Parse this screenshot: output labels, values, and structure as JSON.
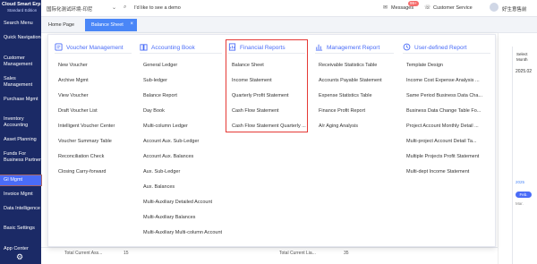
{
  "app": {
    "brand_line1": "Cloud Smart Erp",
    "brand_line2": "Standard Edition",
    "env_title": "国际化测试环境-印尼",
    "demo_link": "I'd like to see a demo",
    "messages_label": "Messages",
    "messages_badge": "99+",
    "customer_service_label": "Customer Service",
    "user_name": "好生意售前"
  },
  "sidebar": {
    "items": [
      {
        "label": "Search Menu"
      },
      {
        "label": "Quick Navigation"
      },
      {
        "label": "Customer Management"
      },
      {
        "label": "Sales Management"
      },
      {
        "label": "Purchase Mgmt"
      },
      {
        "label": "Inventory Accounting"
      },
      {
        "label": "Asset Planning"
      },
      {
        "label": "Funds For Business Partner"
      },
      {
        "label": "GI Mgmt"
      },
      {
        "label": "Invoice Mgmt"
      },
      {
        "label": "Data Intelligence"
      },
      {
        "label": "Basic Settings"
      },
      {
        "label": "App Center"
      }
    ]
  },
  "tabs": {
    "home": "Home Page",
    "active": "Balance Sheet"
  },
  "menu": {
    "columns": [
      {
        "title": "Voucher Management",
        "items": [
          "New Voucher",
          "Archive Mgmt",
          "View Voucher",
          "Draft Voucher List",
          "Intelligent Voucher Center",
          "Voucher Summary Table",
          "Reconciliation Check",
          "Closing Carry-forward"
        ]
      },
      {
        "title": "Accounting Book",
        "items": [
          "General Ledger",
          "Sub-ledger",
          "Balance Report",
          "Day Book",
          "Multi-column Ledger",
          "Account Aux. Sub-Ledger",
          "Account Aux. Balances",
          "Aux. Sub-Ledger",
          "Aux. Balances",
          "Multi-Auxiliary Detailed Account",
          "Multi-Auxiliary Balances",
          "Multi-Auxiliary Multi-column Account"
        ]
      },
      {
        "title": "Financial Reports",
        "items": [
          "Balance Sheet",
          "Income Statement",
          "Quarterly Profit Statement",
          "Cash Flow Statement",
          "Cash Flow Statement Quarterly ..."
        ]
      },
      {
        "title": "Management Report",
        "items": [
          "Receivable Statistics Table",
          "Accounts Payable Statement",
          "Expense Statistics Table",
          "Finance Profit Report",
          "A/r Aging Analysis"
        ]
      },
      {
        "title": "User-defined Report",
        "items": [
          "Template Design",
          "Income Cost Expense Analysis ...",
          "Same Period Business Data Cha...",
          "Business Data Change Table Fo...",
          "Project Account Monthly Detail ...",
          "Multi-project Account Detail Ta...",
          "Multiple Projects Profit Statement",
          "Multi-dept Income Statement"
        ]
      }
    ]
  },
  "background_table": {
    "cells": [
      "Total Current Ass...",
      "15",
      "Total Current Lia...",
      "35"
    ]
  },
  "date_picker": {
    "label": "Select Month",
    "value": "2025.02",
    "months": [
      "Feb.",
      "Mar."
    ],
    "selected_month": "Feb.",
    "year_marker": "2025"
  },
  "colors": {
    "sidebar_bg": "#1b2a66",
    "accent": "#4a6cf7",
    "tab_active": "#4a86f7",
    "highlight_border": "#e53935"
  }
}
